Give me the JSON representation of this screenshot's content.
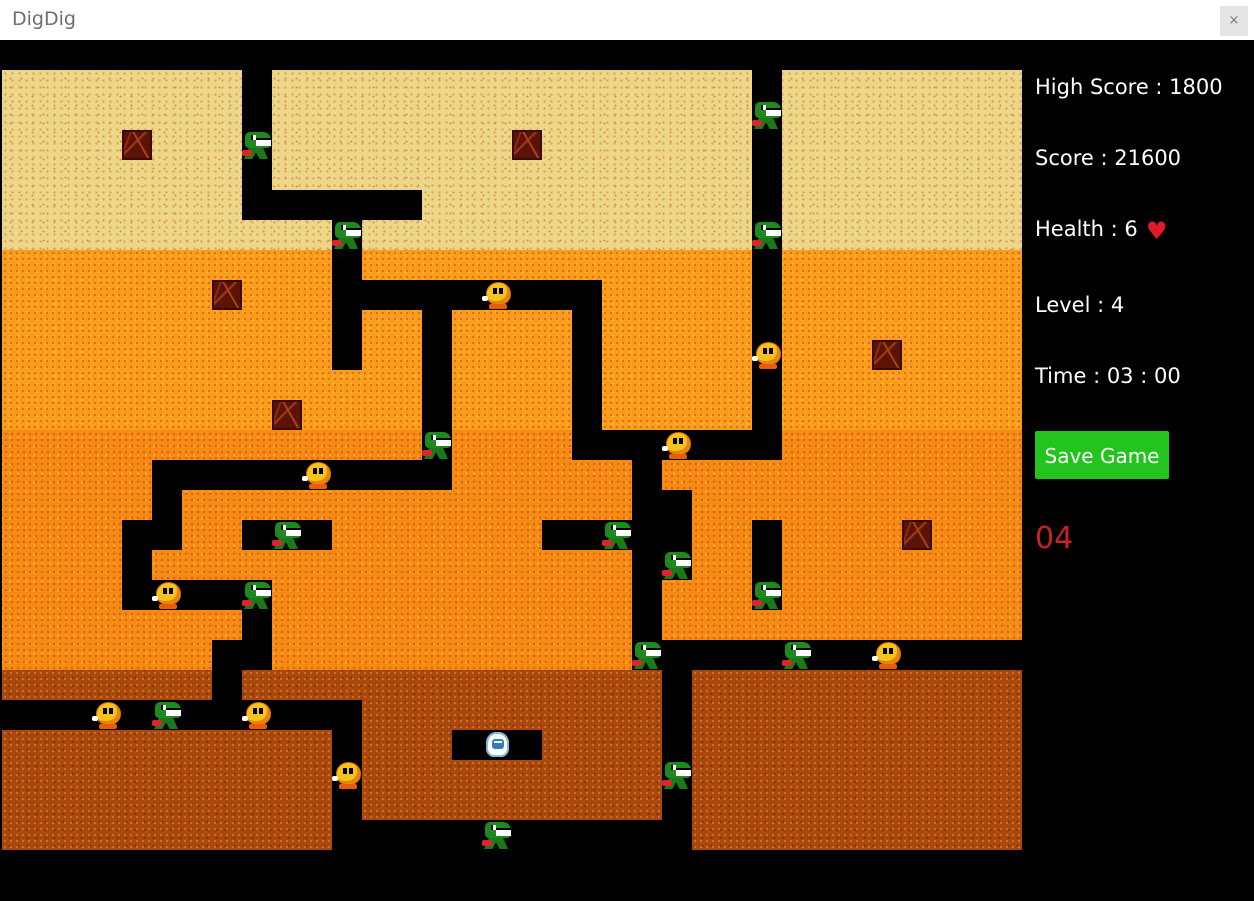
{
  "window": {
    "title": "DigDig",
    "close_glyph": "×"
  },
  "hud": {
    "high_score": "High Score : 1800",
    "score": "Score : 21600",
    "health": "Health : 6",
    "health_icon": "heart-icon",
    "level": "Level : 4",
    "time": "Time : 03 : 00",
    "save_button": "Save Game",
    "counter": "04"
  },
  "colors": {
    "layer1": "#ecd687",
    "layer2": "#f99d1b",
    "layer3": "#f68b14",
    "layer4": "#a9480c",
    "save_button": "#23c41d",
    "counter": "#c8202a",
    "heart": "#e3192b"
  }
}
